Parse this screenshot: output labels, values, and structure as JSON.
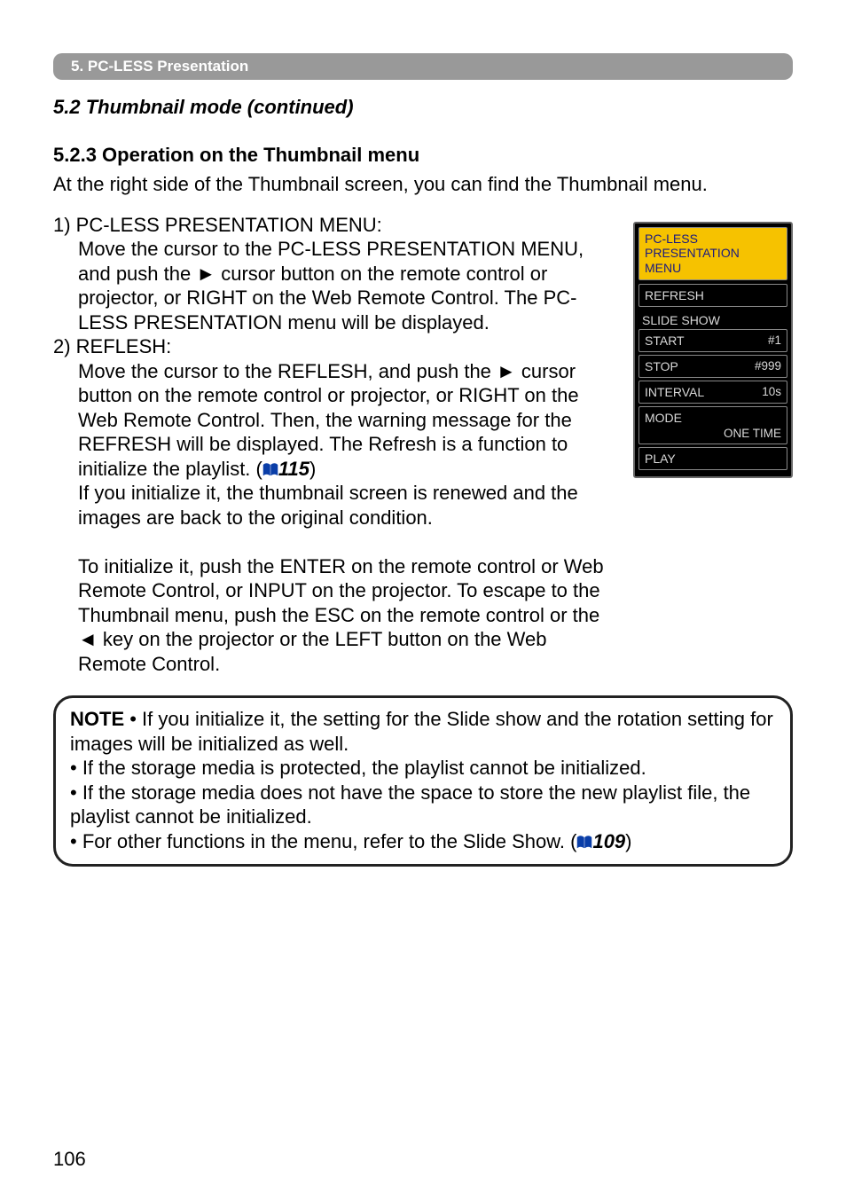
{
  "banner": "5. PC-LESS Presentation",
  "subtitle": "5.2 Thumbnail mode (continued)",
  "section_heading": "5.2.3 Operation on the Thumbnail menu",
  "intro": "At the right side of the Thumbnail screen, you can find the Thumbnail menu.",
  "item1_head": "1) PC-LESS PRESENTATION MENU:",
  "item1_body": "Move the cursor to the PC-LESS PRESENTATION MENU, and push the ► cursor button on the remote control or projector, or RIGHT on the Web Remote Control. The PC-LESS PRESENTATION menu will be displayed.",
  "item2_head": "2) REFLESH:",
  "item2_body_a": "Move the cursor to the REFLESH, and push the ► cursor button on the remote control or projector, or RIGHT on the Web Remote Control. Then, the warning message for the REFRESH will be displayed. The Refresh is a function to initialize the playlist. (",
  "item2_ref": "115",
  "item2_body_b": ")",
  "item2_body_c": "If you initialize it, the thumbnail screen is renewed and the images are back to the original condition.",
  "item2_body_d": "To initialize it, push the ENTER on the remote control or Web Remote Control, or INPUT on the projector. To escape to the Thumbnail menu, push the ESC on the remote control or the ◄ key on the projector or the LEFT button on the Web Remote Control.",
  "menu": {
    "title_l1": "PC-LESS",
    "title_l2": "PRESENTATION",
    "title_l3": "MENU",
    "refresh": "REFRESH",
    "slideshow_label": "SLIDE SHOW",
    "start_label": "START",
    "start_val": "#1",
    "stop_label": "STOP",
    "stop_val": "#999",
    "interval_label": "INTERVAL",
    "interval_val": "10s",
    "mode_label": "MODE",
    "mode_val": "ONE TIME",
    "play": "PLAY"
  },
  "note": {
    "label": "NOTE",
    "b1": " • If you initialize it, the setting for the Slide show and the rotation setting for images will be initialized as well.",
    "b2": "• If the storage media is protected, the playlist cannot be initialized.",
    "b3": "• If the storage media does not have the space to store the new playlist file, the playlist cannot be initialized.",
    "b4a": "• For other functions in the menu, refer to the Slide Show. (",
    "b4ref": "109",
    "b4b": ")"
  },
  "page_number": "106"
}
